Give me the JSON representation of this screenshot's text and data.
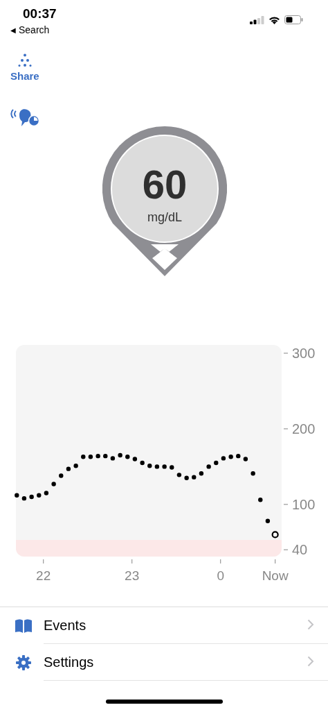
{
  "status_bar": {
    "time": "00:37",
    "back_arrow": "◀",
    "back_label": "Search"
  },
  "share": {
    "label": "Share"
  },
  "reading": {
    "value": "60",
    "unit": "mg/dL"
  },
  "chart": {
    "after_midnight_labels": [
      "0",
      "Now"
    ],
    "chart_data": {
      "type": "scatter",
      "x": [
        21.7,
        21.783,
        21.867,
        21.95,
        22.033,
        22.117,
        22.2,
        22.283,
        22.367,
        22.45,
        22.533,
        22.617,
        22.7,
        22.783,
        22.867,
        22.95,
        23.033,
        23.117,
        23.2,
        23.283,
        23.367,
        23.45,
        23.533,
        23.617,
        23.7,
        23.783,
        23.867,
        23.95,
        24.033,
        24.117,
        24.2,
        24.283,
        24.367,
        24.45,
        24.533,
        24.617
      ],
      "series": [
        {
          "color": "#000000",
          "values": [
            112,
            108,
            110,
            112,
            115,
            127,
            138,
            147,
            151,
            163,
            163,
            164,
            164,
            161,
            165,
            163,
            160,
            155,
            151,
            150,
            150,
            149,
            139,
            135,
            136,
            141,
            150,
            155,
            161,
            163,
            164,
            160,
            141,
            106,
            78,
            60
          ]
        }
      ],
      "xlim": [
        21.69,
        24.69
      ],
      "ylim": [
        31,
        311
      ],
      "xticks": [
        22,
        23
      ],
      "yticks": [
        300,
        200,
        100,
        40
      ],
      "bands": [
        {
          "axis": "y",
          "from": 31,
          "to": 53,
          "color": "#fce8e8"
        }
      ]
    }
  },
  "menu": [
    {
      "kind": "book",
      "label": "Events"
    },
    {
      "kind": "gear",
      "label": "Settings"
    }
  ]
}
